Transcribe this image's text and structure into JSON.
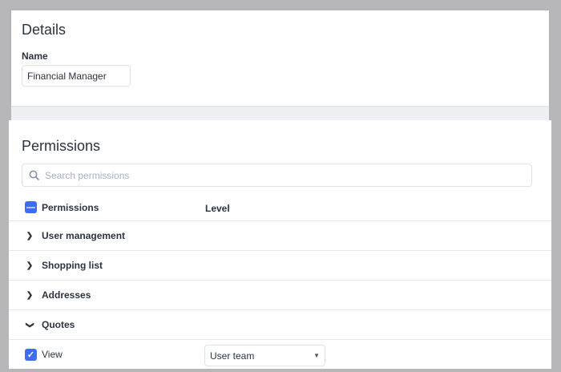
{
  "details": {
    "title": "Details",
    "name_label": "Name",
    "name_value": "Financial Manager"
  },
  "permissions": {
    "title": "Permissions",
    "search_placeholder": "Search  permissions",
    "col_permissions": "Permissions",
    "col_level": "Level",
    "groups": [
      {
        "label": "User management",
        "expanded": false
      },
      {
        "label": "Shopping list",
        "expanded": false
      },
      {
        "label": "Addresses",
        "expanded": false
      },
      {
        "label": "Quotes",
        "expanded": true
      }
    ],
    "view_label": "View",
    "view_level": "User team"
  }
}
